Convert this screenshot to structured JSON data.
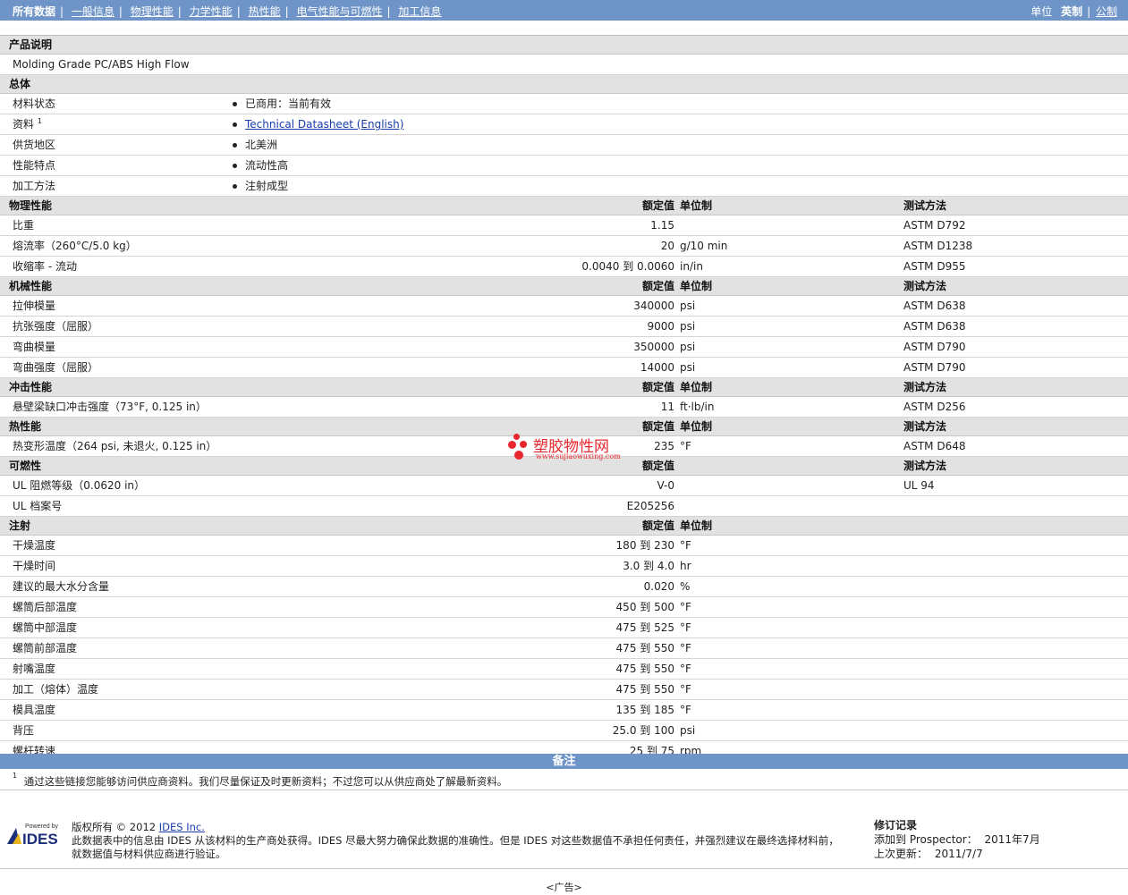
{
  "nav": {
    "all_data": "所有数据",
    "tabs": [
      "一般信息",
      "物理性能",
      "力学性能",
      "热性能",
      "电气性能与可燃性",
      "加工信息"
    ],
    "units_label": "单位",
    "imperial": "英制",
    "metric": "公制"
  },
  "sections": {
    "product_desc": "产品说明",
    "product_text": "Molding Grade PC/ABS High Flow",
    "general": "总体",
    "general_items": [
      {
        "label": "材料状态",
        "value": "已商用：当前有效"
      },
      {
        "label": "资料",
        "sup": "1",
        "value": "Technical Datasheet (English)"
      },
      {
        "label": "供货地区",
        "value": "北美洲"
      },
      {
        "label": "性能特点",
        "value": "流动性高"
      },
      {
        "label": "加工方法",
        "value": "注射成型"
      }
    ],
    "col_nominal": "额定值",
    "col_unit": "单位制",
    "col_method": "测试方法",
    "physical": "物理性能",
    "physical_rows": [
      {
        "name": "比重",
        "value": "1.15",
        "unit": "",
        "method": "ASTM D792"
      },
      {
        "name": "熔流率（260°C/5.0 kg）",
        "value": "20",
        "unit": "g/10 min",
        "method": "ASTM D1238"
      },
      {
        "name": "收缩率 - 流动",
        "value": "0.0040 到 0.0060",
        "unit": "in/in",
        "method": "ASTM D955"
      }
    ],
    "mechanical": "机械性能",
    "mechanical_rows": [
      {
        "name": "拉伸模量",
        "value": "340000",
        "unit": "psi",
        "method": "ASTM D638"
      },
      {
        "name": "抗张强度（屈服）",
        "value": "9000",
        "unit": "psi",
        "method": "ASTM D638"
      },
      {
        "name": "弯曲模量",
        "value": "350000",
        "unit": "psi",
        "method": "ASTM D790"
      },
      {
        "name": "弯曲强度（屈服）",
        "value": "14000",
        "unit": "psi",
        "method": "ASTM D790"
      }
    ],
    "impact": "冲击性能",
    "impact_rows": [
      {
        "name": "悬壁梁缺口冲击强度（73°F, 0.125 in）",
        "value": "11",
        "unit": "ft·lb/in",
        "method": "ASTM D256"
      }
    ],
    "thermal": "热性能",
    "thermal_rows": [
      {
        "name": "热变形温度（264 psi, 未退火, 0.125 in）",
        "value": "235",
        "unit": "°F",
        "method": "ASTM D648"
      }
    ],
    "flammability": "可燃性",
    "flammability_rows": [
      {
        "name": "UL 阻燃等级（0.0620 in）",
        "value": "V-0",
        "unit": "",
        "method": "UL 94"
      },
      {
        "name": "UL 档案号",
        "value": "E205256",
        "unit": "",
        "method": ""
      }
    ],
    "injection": "注射",
    "injection_rows": [
      {
        "name": "干燥温度",
        "value": "180 到 230",
        "unit": "°F"
      },
      {
        "name": "干燥时间",
        "value": "3.0 到 4.0",
        "unit": "hr"
      },
      {
        "name": "建议的最大水分含量",
        "value": "0.020",
        "unit": "%"
      },
      {
        "name": "螺筒后部温度",
        "value": "450 到 500",
        "unit": "°F"
      },
      {
        "name": "螺筒中部温度",
        "value": "475 到 525",
        "unit": "°F"
      },
      {
        "name": "螺筒前部温度",
        "value": "475 到 550",
        "unit": "°F"
      },
      {
        "name": "射嘴温度",
        "value": "475 到 550",
        "unit": "°F"
      },
      {
        "name": "加工（熔体）温度",
        "value": "475 到 550",
        "unit": "°F"
      },
      {
        "name": "模具温度",
        "value": "135 到 185",
        "unit": "°F"
      },
      {
        "name": "背压",
        "value": "25.0 到 100",
        "unit": "psi"
      },
      {
        "name": "螺杆转速",
        "value": "25 到 75",
        "unit": "rpm"
      }
    ]
  },
  "notes": {
    "title": "备注",
    "sup": "1",
    "text": "通过这些链接您能够访问供应商资料。我们尽量保证及时更新资料；不过您可以从供应商处了解最新资料。"
  },
  "footer": {
    "logo_text": "IDES",
    "logo_small": "Powered by",
    "copyright_prefix": "版权所有 © 2012",
    "company": "IDES Inc.",
    "line2": "此数据表中的信息由 IDES 从该材料的生产商处获得。IDES 尽最大努力确保此数据的准确性。但是 IDES 对这些数据值不承担任何责任，并强烈建议在最终选择材料前，",
    "line3": "就数据值与材料供应商进行验证。",
    "rev_title": "修订记录",
    "added_label": "添加到 Prospector：",
    "added_value": "2011年7月",
    "updated_label": "上次更新：",
    "updated_value": "2011/7/7"
  },
  "watermark": {
    "title": "塑胶物性网",
    "url": "www.sujiaowuxing.com"
  },
  "ad": "<广告>",
  "colors": {
    "nav_bg": "#6f95c8",
    "header_row": "#e2e2e2",
    "link": "#1a3faa",
    "watermark": "#e8262d"
  }
}
